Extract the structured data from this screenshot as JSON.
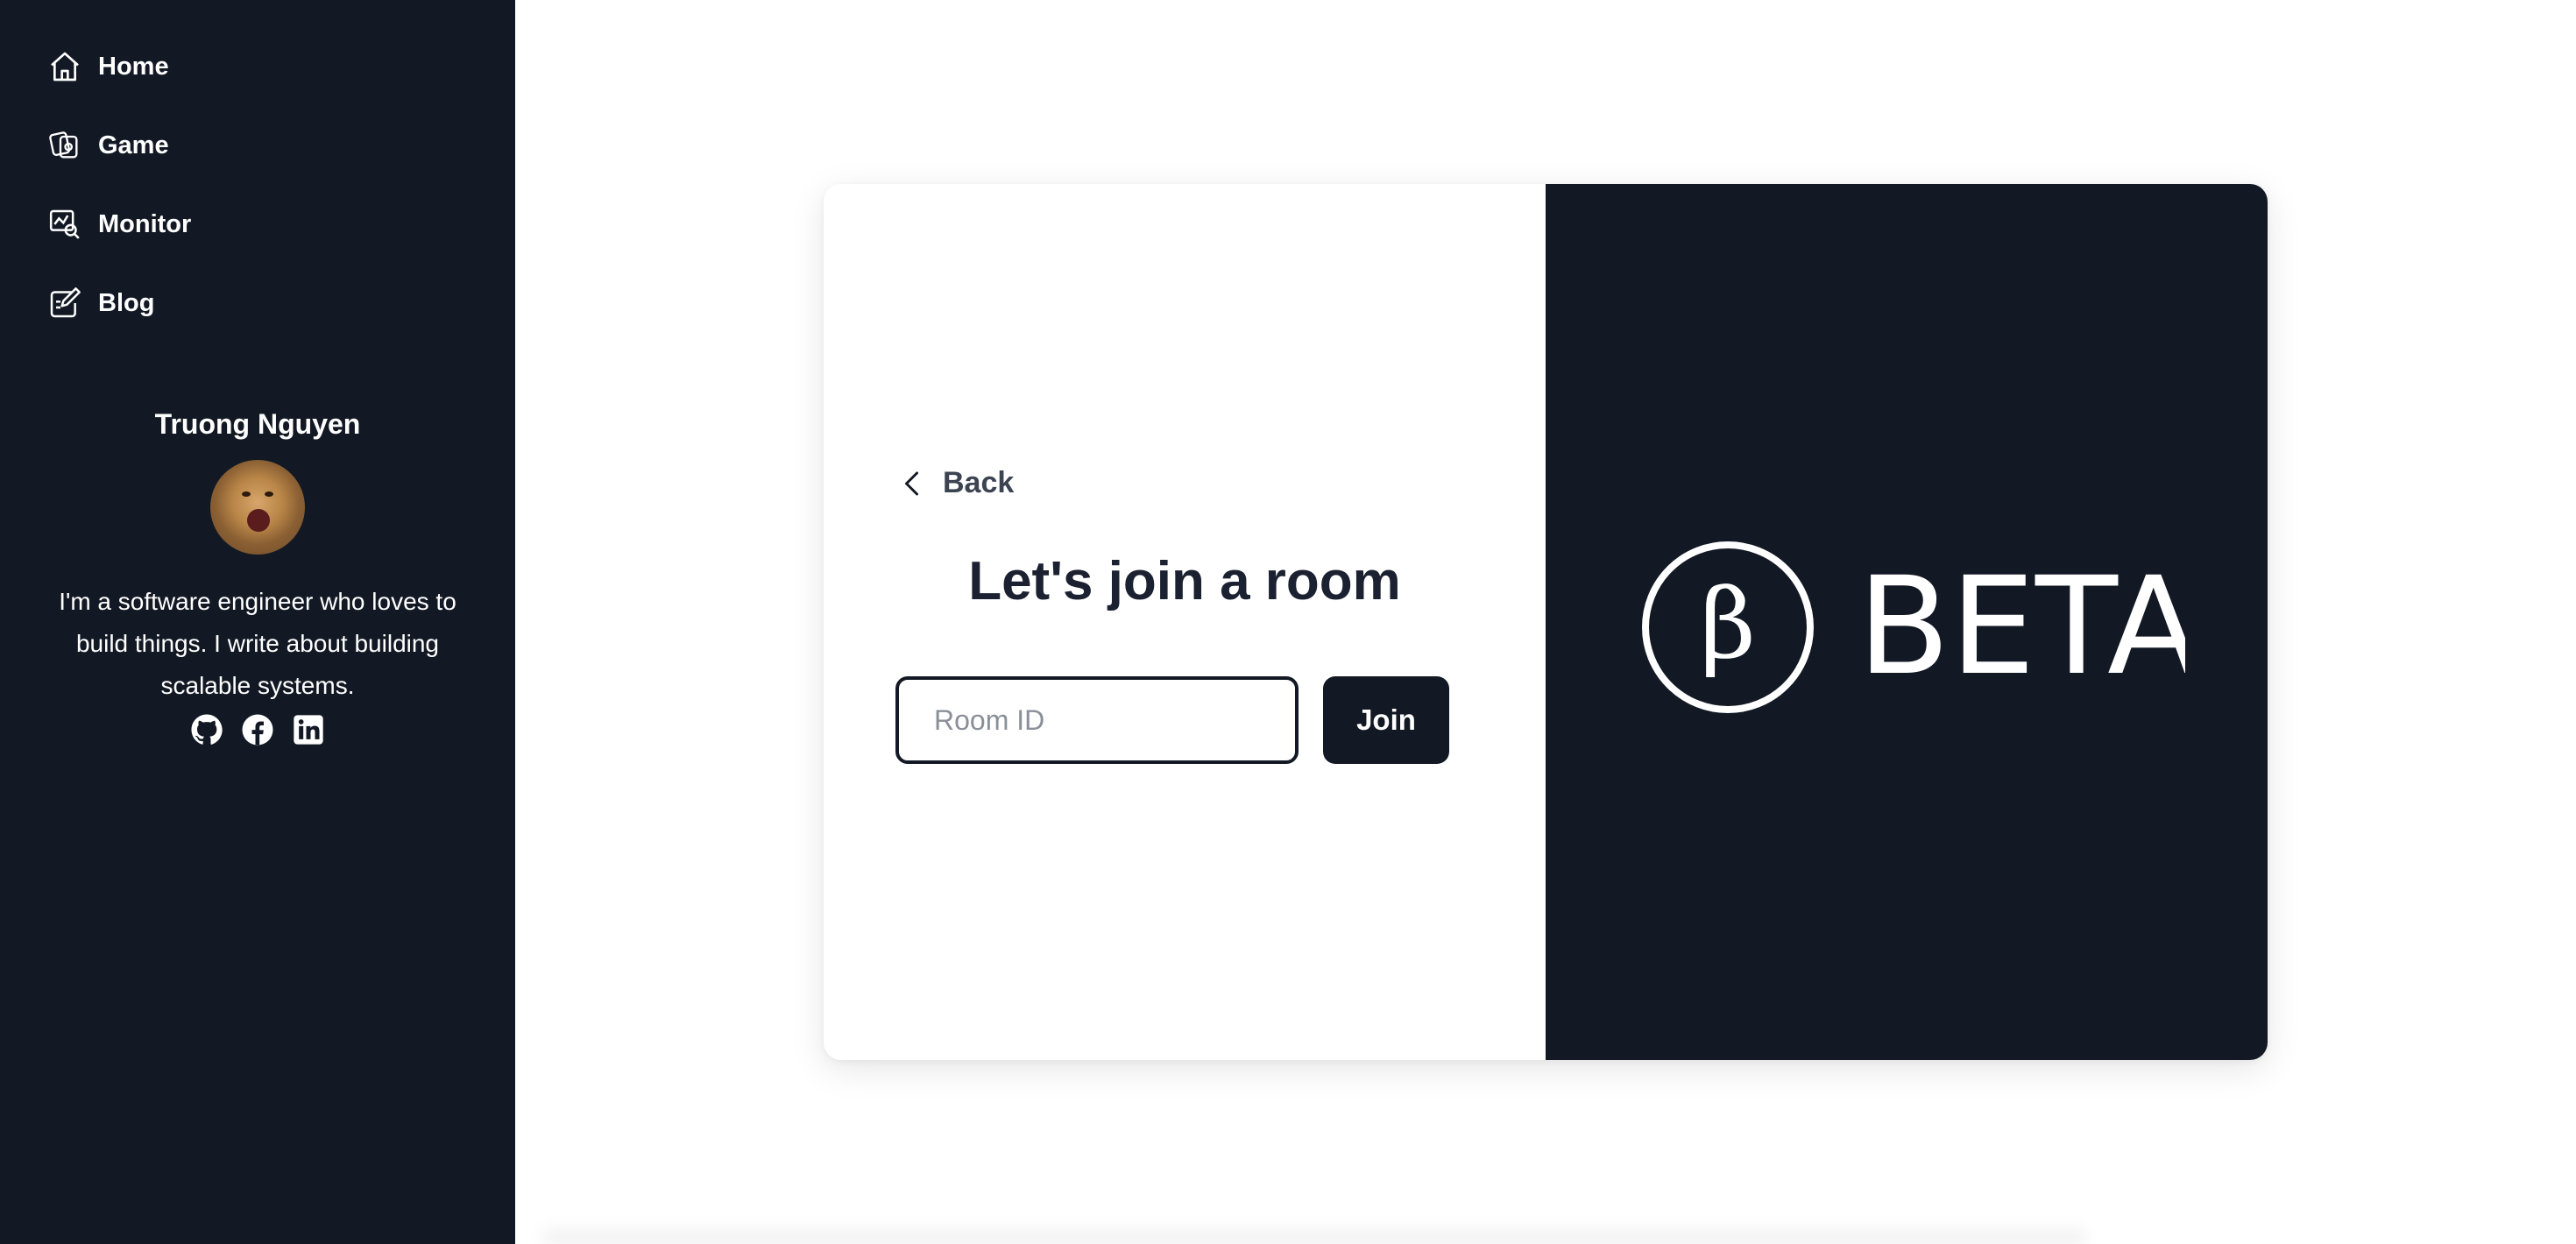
{
  "sidebar": {
    "items": [
      {
        "label": "Home",
        "icon": "home-icon"
      },
      {
        "label": "Game",
        "icon": "game-icon"
      },
      {
        "label": "Monitor",
        "icon": "monitor-icon"
      },
      {
        "label": "Blog",
        "icon": "blog-icon"
      }
    ],
    "profile": {
      "name": "Truong Nguyen",
      "bio": "I'm a software engineer who loves to build things. I write about building scalable systems.",
      "social": [
        "github-icon",
        "facebook-icon",
        "linkedin-icon"
      ]
    }
  },
  "join_room": {
    "back_label": "Back",
    "title": "Let's join a room",
    "input_placeholder": "Room ID",
    "join_label": "Join"
  },
  "banner": {
    "logo_text": "BETA",
    "symbol": "β"
  },
  "colors": {
    "dark": "#131924",
    "background": "#ffffff",
    "back_text": "#3d4451"
  }
}
